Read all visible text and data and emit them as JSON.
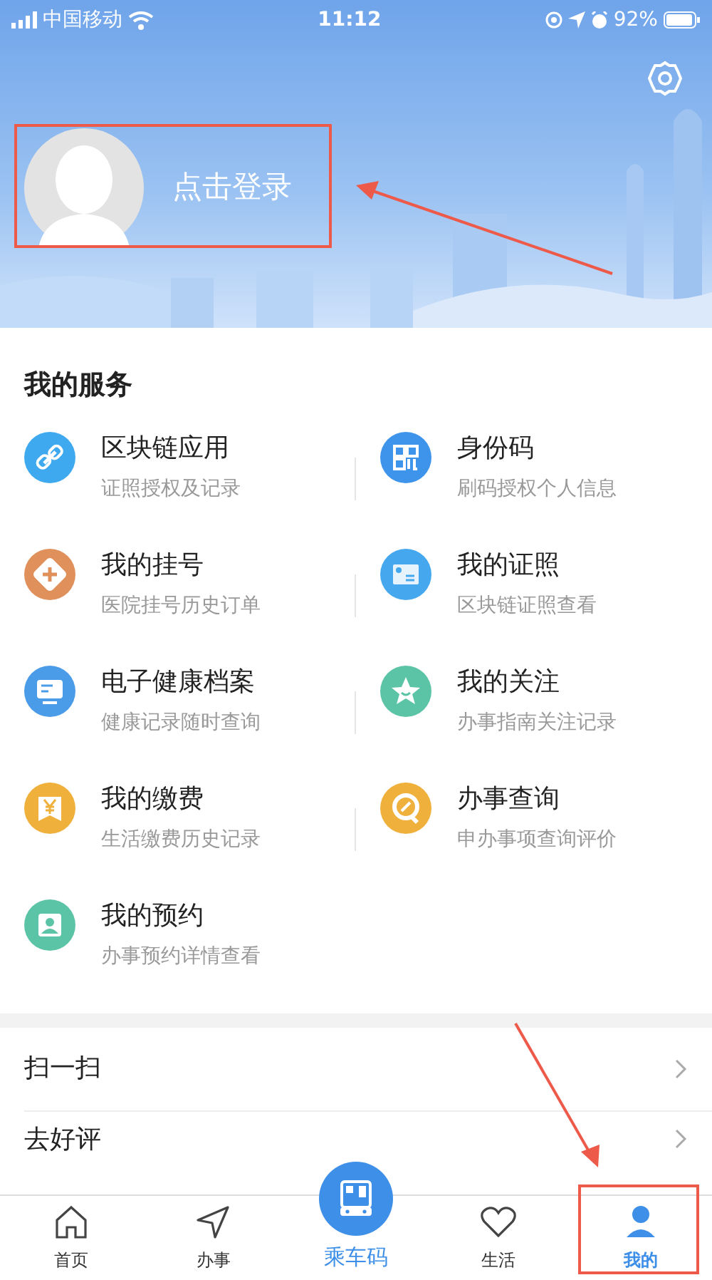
{
  "status_bar": {
    "carrier": "中国移动",
    "time": "11:12",
    "battery": "92%"
  },
  "profile": {
    "login_label": "点击登录"
  },
  "services": {
    "title": "我的服务",
    "items": [
      {
        "title": "区块链应用",
        "subtitle": "证照授权及记录",
        "color": "#3fa9f0",
        "kind": "link"
      },
      {
        "title": "身份码",
        "subtitle": "刷码授权个人信息",
        "color": "#3d94ea",
        "kind": "qr"
      },
      {
        "title": "我的挂号",
        "subtitle": "医院挂号历史订单",
        "color": "#e0905a",
        "kind": "plus"
      },
      {
        "title": "我的证照",
        "subtitle": "区块链证照查看",
        "color": "#45a8ee",
        "kind": "card"
      },
      {
        "title": "电子健康档案",
        "subtitle": "健康记录随时查询",
        "color": "#4a9be8",
        "kind": "monitor"
      },
      {
        "title": "我的关注",
        "subtitle": "办事指南关注记录",
        "color": "#5cc4a6",
        "kind": "star"
      },
      {
        "title": "我的缴费",
        "subtitle": "生活缴费历史记录",
        "color": "#efb13c",
        "kind": "yen"
      },
      {
        "title": "办事查询",
        "subtitle": "申办事项查询评价",
        "color": "#efb13c",
        "kind": "search"
      },
      {
        "title": "我的预约",
        "subtitle": "办事预约详情查看",
        "color": "#5cc4a6",
        "kind": "person"
      }
    ]
  },
  "menu": [
    {
      "label": "扫一扫"
    },
    {
      "label": "去好评"
    }
  ],
  "tab_bar": [
    {
      "label": "首页",
      "kind": "home",
      "selected": false
    },
    {
      "label": "办事",
      "kind": "send",
      "selected": false
    },
    {
      "label": "乘车码",
      "kind": "center",
      "selected": false
    },
    {
      "label": "生活",
      "kind": "heart",
      "selected": false
    },
    {
      "label": "我的",
      "kind": "me",
      "selected": true
    }
  ]
}
